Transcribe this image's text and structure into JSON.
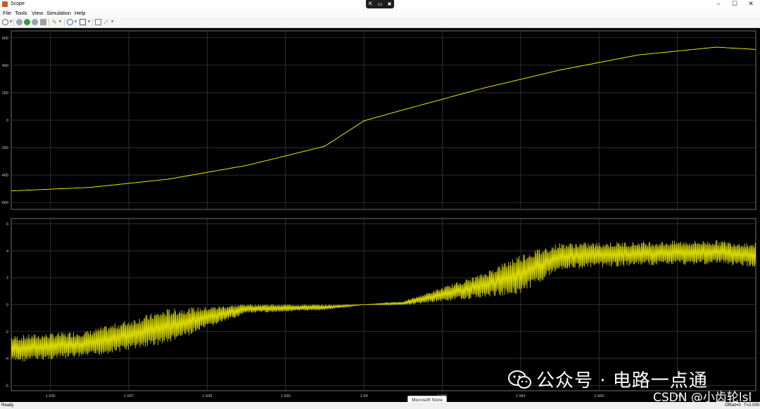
{
  "window": {
    "title": "Scope",
    "min_label": "–",
    "max_label": "☐",
    "close_label": "✕",
    "center_controls": [
      "⇱",
      "▭",
      "✖"
    ]
  },
  "menu": [
    "File",
    "Tools",
    "View",
    "Simulation",
    "Help"
  ],
  "toolbar": {
    "icons": [
      "settings-icon",
      "step-back-icon",
      "run-icon",
      "step-forward-icon",
      "stop-icon",
      "highlight-icon",
      "zoom-icon",
      "scale-axes-icon",
      "style-icon"
    ]
  },
  "status": {
    "left": "Ready",
    "offset": "Offset=0",
    "time": "T=2.000"
  },
  "tooltip": "Microsoft Store",
  "watermark": {
    "line1": "公众号 · 电路一点通",
    "line2": "CSDN @小齿轮lsl"
  },
  "colors": {
    "plot_bg": "#000000",
    "grid": "#3a3a3a",
    "trace": "#ffff00",
    "tick_text": "#c8c8c8"
  },
  "chart_data": [
    {
      "type": "line",
      "title": "",
      "xlabel": "",
      "ylabel": "",
      "xlim": [
        1.9355,
        1.945
      ],
      "ylim": [
        -650,
        650
      ],
      "y_ticks": [
        600,
        400,
        200,
        0,
        -200,
        -400,
        -600
      ],
      "y_tick_labels": [
        "600",
        "400",
        "200",
        "0",
        "-200",
        "-400",
        "-600"
      ],
      "grid": true,
      "series": [
        {
          "color": "#ffff00",
          "x": [
            1.9355,
            1.9365,
            1.9375,
            1.9385,
            1.9395,
            1.94,
            1.9405,
            1.9415,
            1.9425,
            1.9435,
            1.9445,
            1.945
          ],
          "y": [
            -515,
            -490,
            -430,
            -330,
            -190,
            -5,
            75,
            230,
            365,
            475,
            532,
            515
          ]
        }
      ]
    },
    {
      "type": "line",
      "title": "",
      "xlabel": "",
      "ylabel": "",
      "xlim": [
        1.9355,
        1.945
      ],
      "ylim": [
        -6.4,
        6.4
      ],
      "x_ticks": [
        1.936,
        1.937,
        1.938,
        1.939,
        1.94,
        1.941,
        1.942,
        1.943,
        1.944
      ],
      "x_tick_labels": [
        "1.936",
        "1.937",
        "1.938",
        "1.939",
        "1.94",
        "1.941",
        "1.942",
        "1.943",
        "1.944"
      ],
      "y_ticks": [
        6,
        4,
        2,
        0,
        -2,
        -4,
        -6
      ],
      "y_tick_labels": [
        "6",
        "4",
        "2",
        "0",
        "-2",
        "-4",
        "-6"
      ],
      "grid": true,
      "series": [
        {
          "color": "#ffff00",
          "center_x": [
            1.9355,
            1.9365,
            1.9375,
            1.9385,
            1.9395,
            1.94,
            1.9405,
            1.9415,
            1.942,
            1.9425,
            1.9435,
            1.9445,
            1.945
          ],
          "center_y": [
            -3.3,
            -2.9,
            -1.6,
            -0.3,
            -0.2,
            0.0,
            0.1,
            1.4,
            2.3,
            3.6,
            3.8,
            3.9,
            3.7
          ],
          "band_half_width": [
            1.0,
            1.0,
            1.3,
            0.35,
            0.2,
            0.0,
            0.15,
            0.9,
            1.5,
            1.0,
            0.9,
            0.9,
            0.9
          ],
          "clamp_zero_range": [
            1.9378,
            1.942
          ]
        }
      ]
    }
  ]
}
